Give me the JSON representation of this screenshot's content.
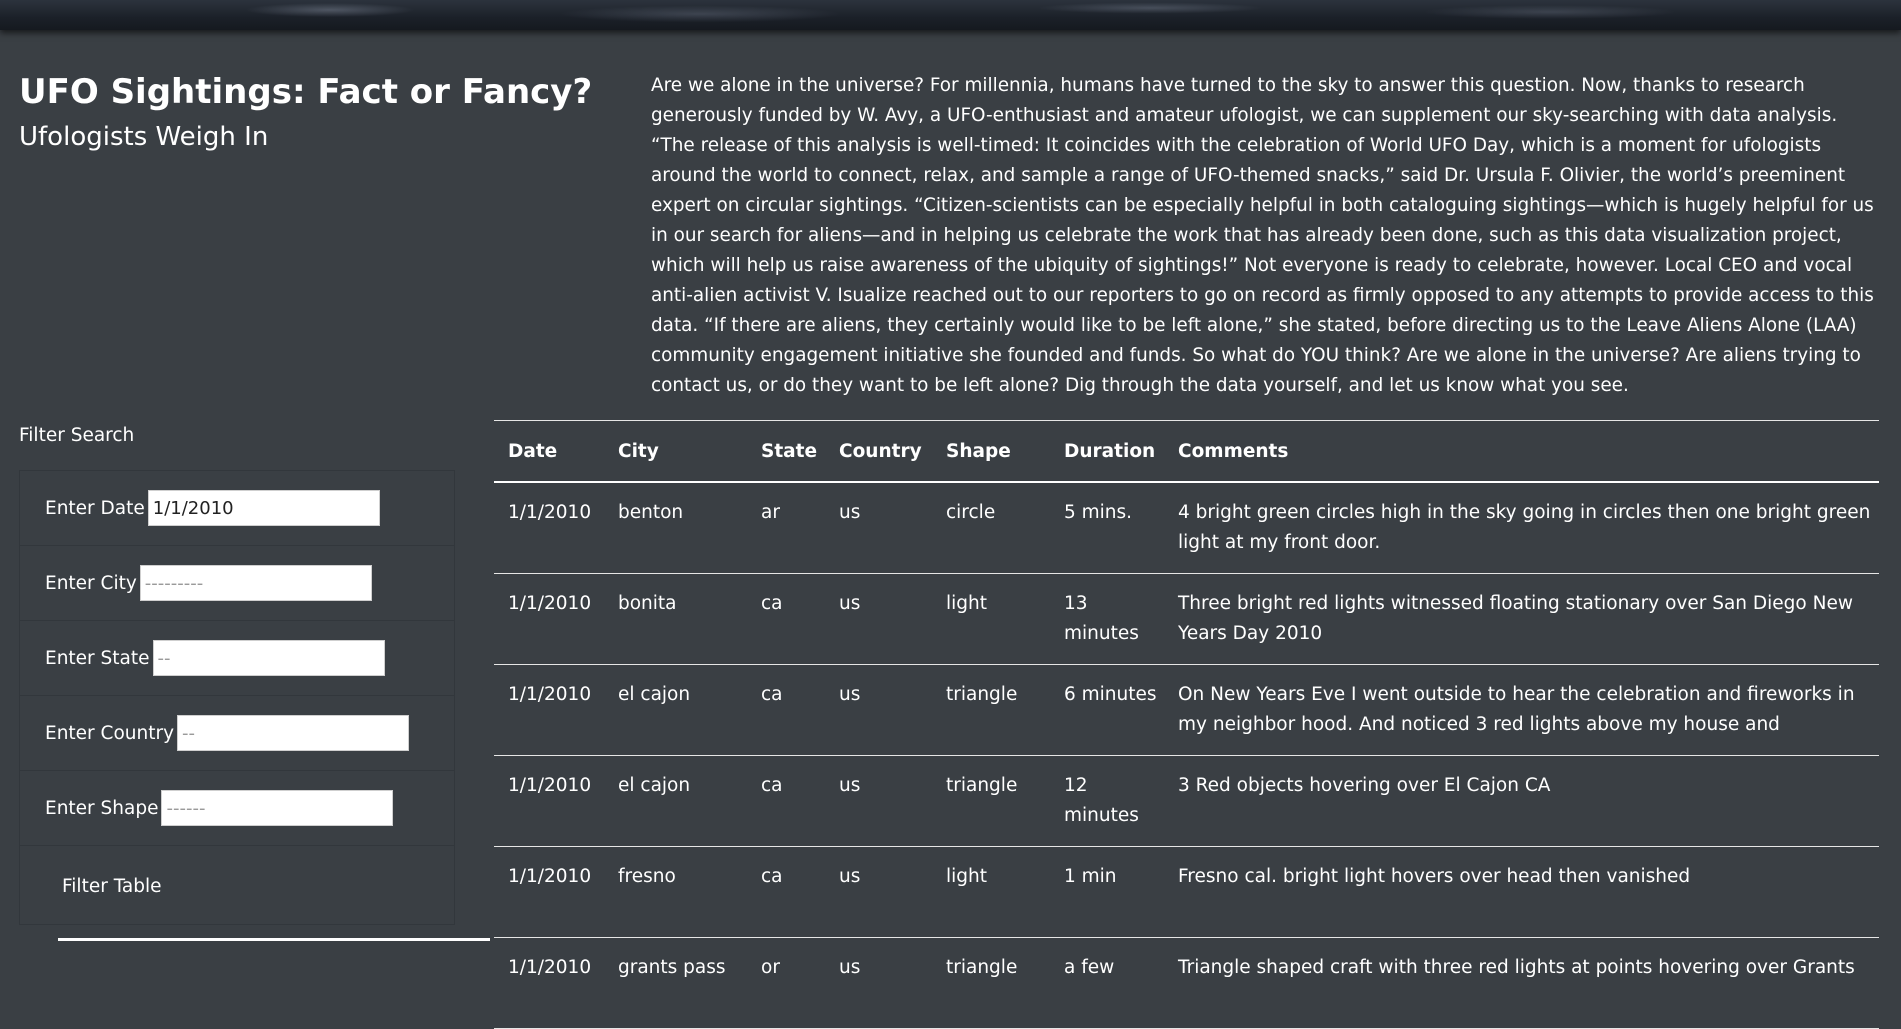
{
  "header": {
    "title": "UFO Sightings: Fact or Fancy?",
    "subtitle": "Ufologists Weigh In"
  },
  "intro": "Are we alone in the universe? For millennia, humans have turned to the sky to answer this question. Now, thanks to research generously funded by W. Avy, a UFO-enthusiast and amateur ufologist, we can supplement our sky-searching with data analysis. “The release of this analysis is well-timed: It coincides with the celebration of World UFO Day, which is a moment for ufologists around the world to connect, relax, and sample a range of UFO-themed snacks,” said Dr. Ursula F. Olivier, the world’s preeminent expert on circular sightings. “Citizen-scientists can be especially helpful in both cataloguing sightings—which is hugely helpful for us in our search for aliens—and in helping us celebrate the work that has already been done, such as this data visualization project, which will help us raise awareness of the ubiquity of sightings!” Not everyone is ready to celebrate, however. Local CEO and vocal anti-alien activist V. Isualize reached out to our reporters to go on record as firmly opposed to any attempts to provide access to this data. “If there are aliens, they certainly would like to be left alone,” she stated, before directing us to the Leave Aliens Alone (LAA) community engagement initiative she founded and funds. So what do YOU think? Are we alone in the universe? Are aliens trying to contact us, or do they want to be left alone? Dig through the data yourself, and let us know what you see.",
  "filters": {
    "heading": "Filter Search",
    "date": {
      "label": "Enter Date",
      "value": "1/1/2010",
      "placeholder": ""
    },
    "city": {
      "label": "Enter City",
      "value": "",
      "placeholder": "---------"
    },
    "state": {
      "label": "Enter State",
      "value": "",
      "placeholder": "--"
    },
    "country": {
      "label": "Enter Country",
      "value": "",
      "placeholder": "--"
    },
    "shape": {
      "label": "Enter Shape",
      "value": "",
      "placeholder": "------"
    },
    "button_label": "Filter Table"
  },
  "table": {
    "columns": [
      "Date",
      "City",
      "State",
      "Country",
      "Shape",
      "Duration",
      "Comments"
    ],
    "rows": [
      [
        "1/1/2010",
        "benton",
        "ar",
        "us",
        "circle",
        "5 mins.",
        "4 bright green circles high in the sky going in circles then one bright green light at my front door."
      ],
      [
        "1/1/2010",
        "bonita",
        "ca",
        "us",
        "light",
        "13 minutes",
        "Three bright red lights witnessed floating stationary over San Diego New Years Day 2010"
      ],
      [
        "1/1/2010",
        "el cajon",
        "ca",
        "us",
        "triangle",
        "6 minutes",
        "On New Years Eve I went outside to hear the celebration and fireworks in my neighbor hood. And noticed 3 red lights above my house and"
      ],
      [
        "1/1/2010",
        "el cajon",
        "ca",
        "us",
        "triangle",
        "12 minutes",
        "3 Red objects hovering over El Cajon CA"
      ],
      [
        "1/1/2010",
        "fresno",
        "ca",
        "us",
        "light",
        "1 min",
        "Fresno cal. bright light hovers over head then vanished"
      ],
      [
        "1/1/2010",
        "grants pass",
        "or",
        "us",
        "triangle",
        "a few",
        "Triangle shaped craft with three red lights at points hovering over Grants"
      ]
    ]
  }
}
